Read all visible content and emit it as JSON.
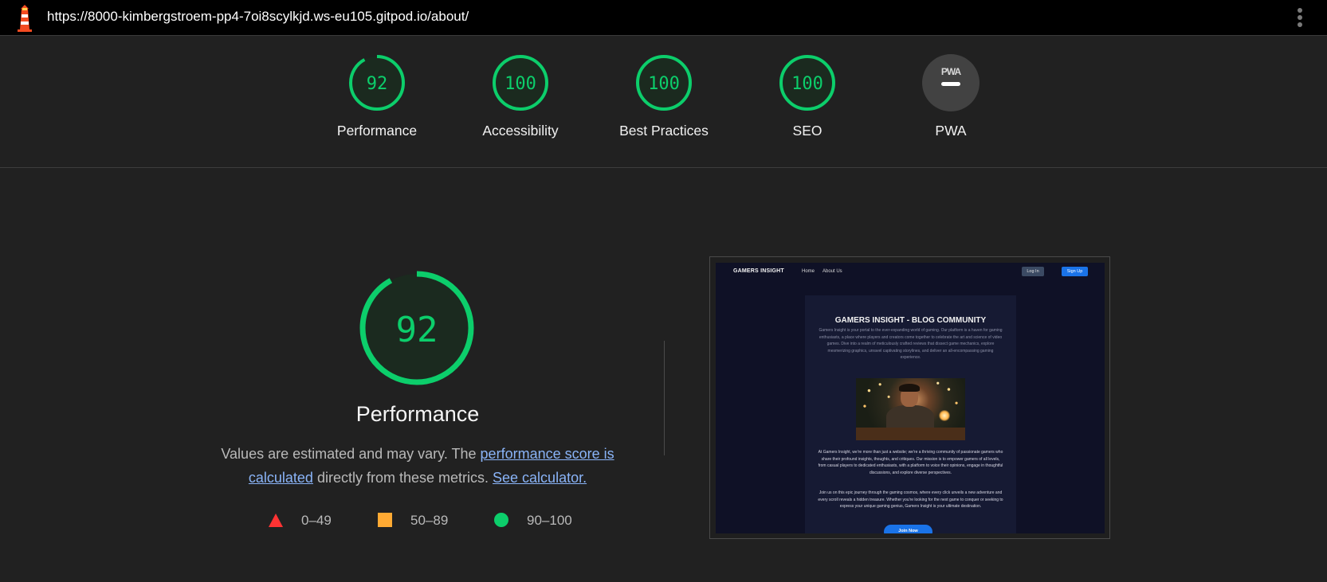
{
  "browser": {
    "url": "https://8000-kimbergstroem-pp4-7oi8scylkjd.ws-eu105.gitpod.io/about/"
  },
  "gauges": [
    {
      "label": "Performance",
      "score": "92",
      "fraction": 0.92
    },
    {
      "label": "Accessibility",
      "score": "100",
      "fraction": 1.0
    },
    {
      "label": "Best Practices",
      "score": "100",
      "fraction": 1.0
    },
    {
      "label": "SEO",
      "score": "100",
      "fraction": 1.0
    },
    {
      "label": "PWA",
      "score": "PWA",
      "fraction": 0
    }
  ],
  "performance": {
    "score": "92",
    "fraction": 0.92,
    "title": "Performance",
    "desc_prefix": "Values are estimated and may vary. The ",
    "link_score": "performance score is calculated",
    "desc_mid": " directly from these metrics. ",
    "link_calc": "See calculator."
  },
  "legend": [
    {
      "shape": "triangle",
      "range": "0–49",
      "color": "#ff3333"
    },
    {
      "shape": "square",
      "range": "50–89",
      "color": "#ffaa33"
    },
    {
      "shape": "circle",
      "range": "90–100",
      "color": "#0cce6b"
    }
  ],
  "colors": {
    "pass": "#0cce6b",
    "pass_bg": "#1b2a1f",
    "pwa_bg": "#424242"
  },
  "screenshot": {
    "brand": "GAMERS INSIGHT",
    "nav": [
      "Home",
      "About Us"
    ],
    "login": "Log In",
    "signup": "Sign Up",
    "title": "GAMERS INSIGHT - BLOG COMMUNITY",
    "intro": "Gamers Insight is your portal to the ever-expanding world of gaming. Our platform is a haven for gaming enthusiasts, a place where players and creators come together to celebrate the art and science of video games. Dive into a realm of meticulously crafted reviews that dissect game mechanics, explore mesmerizing graphics, unravel captivating storylines, and deliver an all-encompassing gaming experience.",
    "para1": "At Gamers Insight, we're more than just a website; we're a thriving community of passionate gamers who share their profound insights, thoughts, and critiques. Our mission is to empower gamers of all levels, from casual players to dedicated enthusiasts, with a platform to voice their opinions, engage in thoughtful discussions, and explore diverse perspectives.",
    "para2": "Join us on this epic journey through the gaming cosmos, where every click unveils a new adventure and every scroll reveals a hidden treasure. Whether you're looking for the next game to conquer or seeking to express your unique gaming genius, Gamers Insight is your ultimate destination.",
    "join": "Join Now"
  }
}
